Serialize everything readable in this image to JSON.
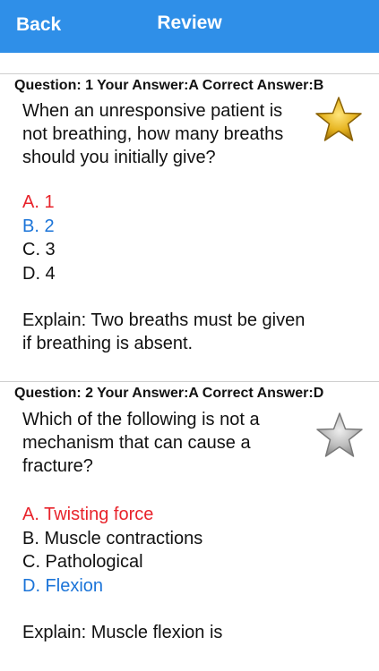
{
  "nav": {
    "back_label": "Back",
    "title": "Review"
  },
  "accent_color": "#2f8fe8",
  "wrong_color": "#e8232b",
  "correct_color": "#1b74d8",
  "questions": [
    {
      "header": "Question: 1 Your Answer:A Correct Answer:B",
      "text": "When an unresponsive patient is not breathing, how many breaths should you initially give?",
      "star": "gold-star-icon",
      "options": [
        "A. 1",
        "B. 2",
        "C. 3",
        "D. 4"
      ],
      "explain": "Explain: Two breaths must be given if breathing is absent."
    },
    {
      "header": "Question: 2 Your Answer:A Correct Answer:D",
      "text": "Which of the following is not a mechanism that can cause a fracture?",
      "star": "gray-star-icon",
      "options": [
        "A. Twisting force",
        "B. Muscle contractions",
        "C. Pathological",
        "D. Flexion"
      ],
      "explain": "Explain: Muscle flexion is"
    }
  ]
}
